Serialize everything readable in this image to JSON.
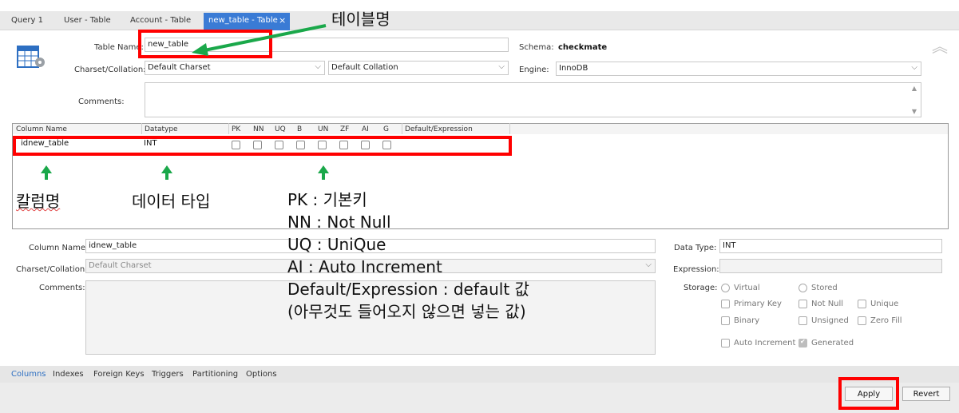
{
  "tabs": [
    {
      "label": "Query 1"
    },
    {
      "label": "User - Table"
    },
    {
      "label": "Account - Table"
    },
    {
      "label": "new_table - Table"
    }
  ],
  "close_glyph": "×",
  "header": {
    "table_name_label": "Table Name:",
    "table_name_value": "new_table",
    "schema_label": "Schema:",
    "schema_value": "checkmate",
    "charset_label": "Charset/Collation:",
    "charset_value": "Default Charset",
    "collation_value": "Default Collation",
    "engine_label": "Engine:",
    "engine_value": "InnoDB",
    "comments_label": "Comments:",
    "collapse_glyph": "︽"
  },
  "columns_grid": {
    "headers": [
      "Column Name",
      "Datatype",
      "PK",
      "NN",
      "UQ",
      "B",
      "UN",
      "ZF",
      "AI",
      "G",
      "Default/Expression"
    ],
    "rows": [
      {
        "name": "idnew_table",
        "datatype": "INT",
        "flags": [
          false,
          false,
          false,
          false,
          false,
          false,
          false,
          false
        ]
      }
    ]
  },
  "detail": {
    "column_name_label": "Column Name:",
    "column_name_value": "idnew_table",
    "charset_label": "Charset/Collation:",
    "charset_value": "Default Charset",
    "comments_label": "Comments:",
    "data_type_label": "Data Type:",
    "data_type_value": "INT",
    "expression_label": "Expression:",
    "storage_label": "Storage:",
    "storage_options": [
      "Virtual",
      "Stored"
    ],
    "flag_options": [
      "Primary Key",
      "Not Null",
      "Unique",
      "Binary",
      "Unsigned",
      "Zero Fill",
      "Auto Increment",
      "Generated"
    ]
  },
  "bottom_tabs": [
    "Columns",
    "Indexes",
    "Foreign Keys",
    "Triggers",
    "Partitioning",
    "Options"
  ],
  "buttons": {
    "apply": "Apply",
    "revert": "Revert"
  },
  "annotations": {
    "table_name_note": "테이블명",
    "column_name_note": "칼럼명",
    "datatype_note": "데이터 타입",
    "lines": [
      "PK : 기본키",
      "NN : Not Null",
      "UQ : UniQue",
      "AI : Auto Increment",
      "Default/Expression : default 값",
      "(아무것도 들어오지 않으면 넣는 값)"
    ]
  },
  "colors": {
    "accent": "#3a7bd5",
    "highlight": "#ff0000",
    "arrow": "#1aa84a"
  }
}
